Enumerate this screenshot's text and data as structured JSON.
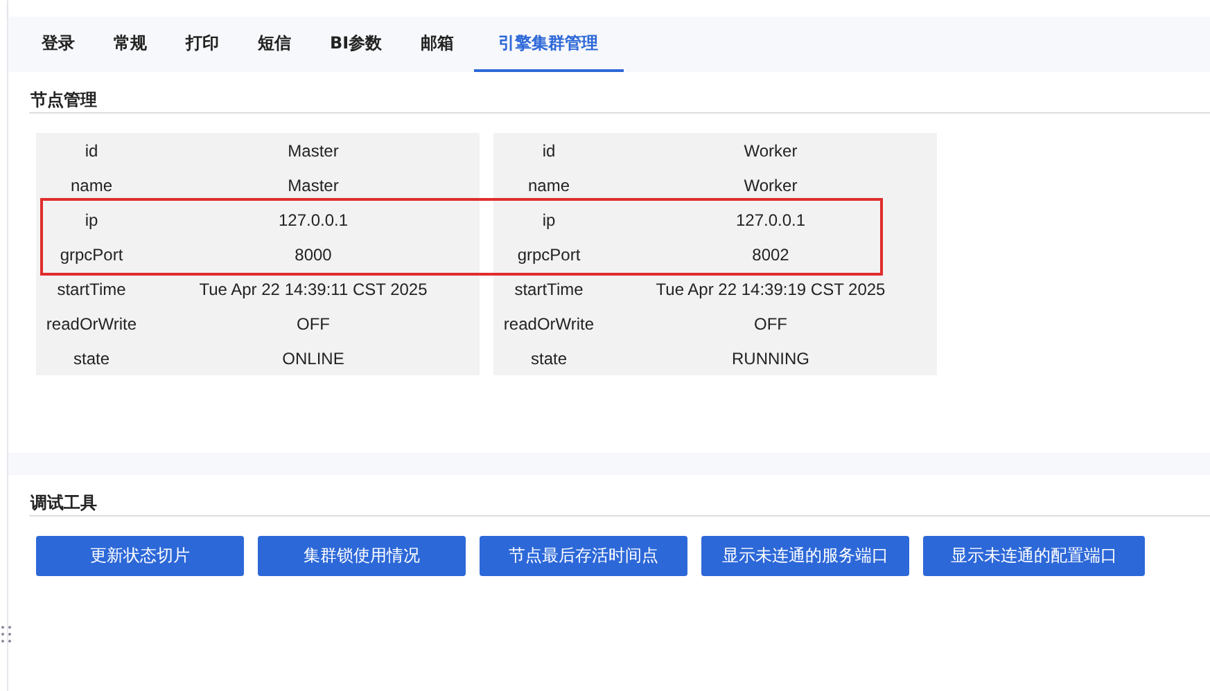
{
  "tabs": [
    {
      "label": "登录",
      "selected": false
    },
    {
      "label": "常规",
      "selected": false
    },
    {
      "label": "打印",
      "selected": false
    },
    {
      "label": "短信",
      "selected": false
    },
    {
      "label": "BI参数",
      "selected": false
    },
    {
      "label": "邮箱",
      "selected": false
    },
    {
      "label": "引擎集群管理",
      "selected": true
    }
  ],
  "node_section": {
    "title": "节点管理",
    "annotation": {
      "kind": "red-box"
    },
    "nodes": [
      {
        "rows": [
          {
            "key": "id",
            "value": "Master",
            "highlighted": false
          },
          {
            "key": "name",
            "value": "Master",
            "highlighted": false
          },
          {
            "key": "ip",
            "value": "127.0.0.1",
            "highlighted": true
          },
          {
            "key": "grpcPort",
            "value": "8000",
            "highlighted": true
          },
          {
            "key": "startTime",
            "value": "Tue Apr 22 14:39:11 CST 2025",
            "highlighted": false
          },
          {
            "key": "readOrWrite",
            "value": "OFF",
            "highlighted": false
          },
          {
            "key": "state",
            "value": "ONLINE",
            "highlighted": false
          }
        ]
      },
      {
        "rows": [
          {
            "key": "id",
            "value": "Worker",
            "highlighted": false
          },
          {
            "key": "name",
            "value": "Worker",
            "highlighted": false
          },
          {
            "key": "ip",
            "value": "127.0.0.1",
            "highlighted": true
          },
          {
            "key": "grpcPort",
            "value": "8002",
            "highlighted": true
          },
          {
            "key": "startTime",
            "value": "Tue Apr 22 14:39:19 CST 2025",
            "highlighted": false
          },
          {
            "key": "readOrWrite",
            "value": "OFF",
            "highlighted": false
          },
          {
            "key": "state",
            "value": "RUNNING",
            "highlighted": false
          }
        ]
      }
    ]
  },
  "debug_section": {
    "title": "调试工具",
    "buttons": [
      "更新状态切片",
      "集群锁使用情况",
      "节点最后存活时间点",
      "显示未连通的服务端口",
      "显示未连通的配置端口"
    ]
  }
}
